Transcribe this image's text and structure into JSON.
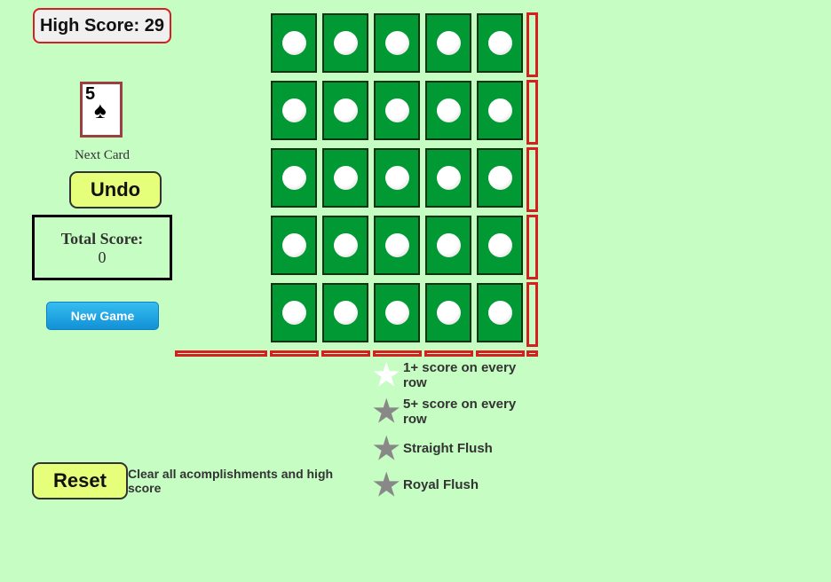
{
  "high_score": "High Score: 29",
  "next_card": {
    "rank": "5",
    "suit": "♠",
    "label": "Next Card"
  },
  "undo": "Undo",
  "total_score": {
    "label": "Total Score:",
    "value": "0"
  },
  "new_game": "New Game",
  "achievements": [
    {
      "text": "1+ score on every row",
      "achieved": true
    },
    {
      "text": "5+ score on every row",
      "achieved": false
    },
    {
      "text": "Straight Flush",
      "achieved": false
    },
    {
      "text": "Royal Flush",
      "achieved": false
    }
  ],
  "reset": "Reset",
  "reset_desc": "Clear all acomplishments and high score",
  "colors": {
    "background": "#c5fdc3",
    "cell": "#009933",
    "score_box": "#d42020",
    "star_on": "#ffffff",
    "star_off": "#888888"
  }
}
